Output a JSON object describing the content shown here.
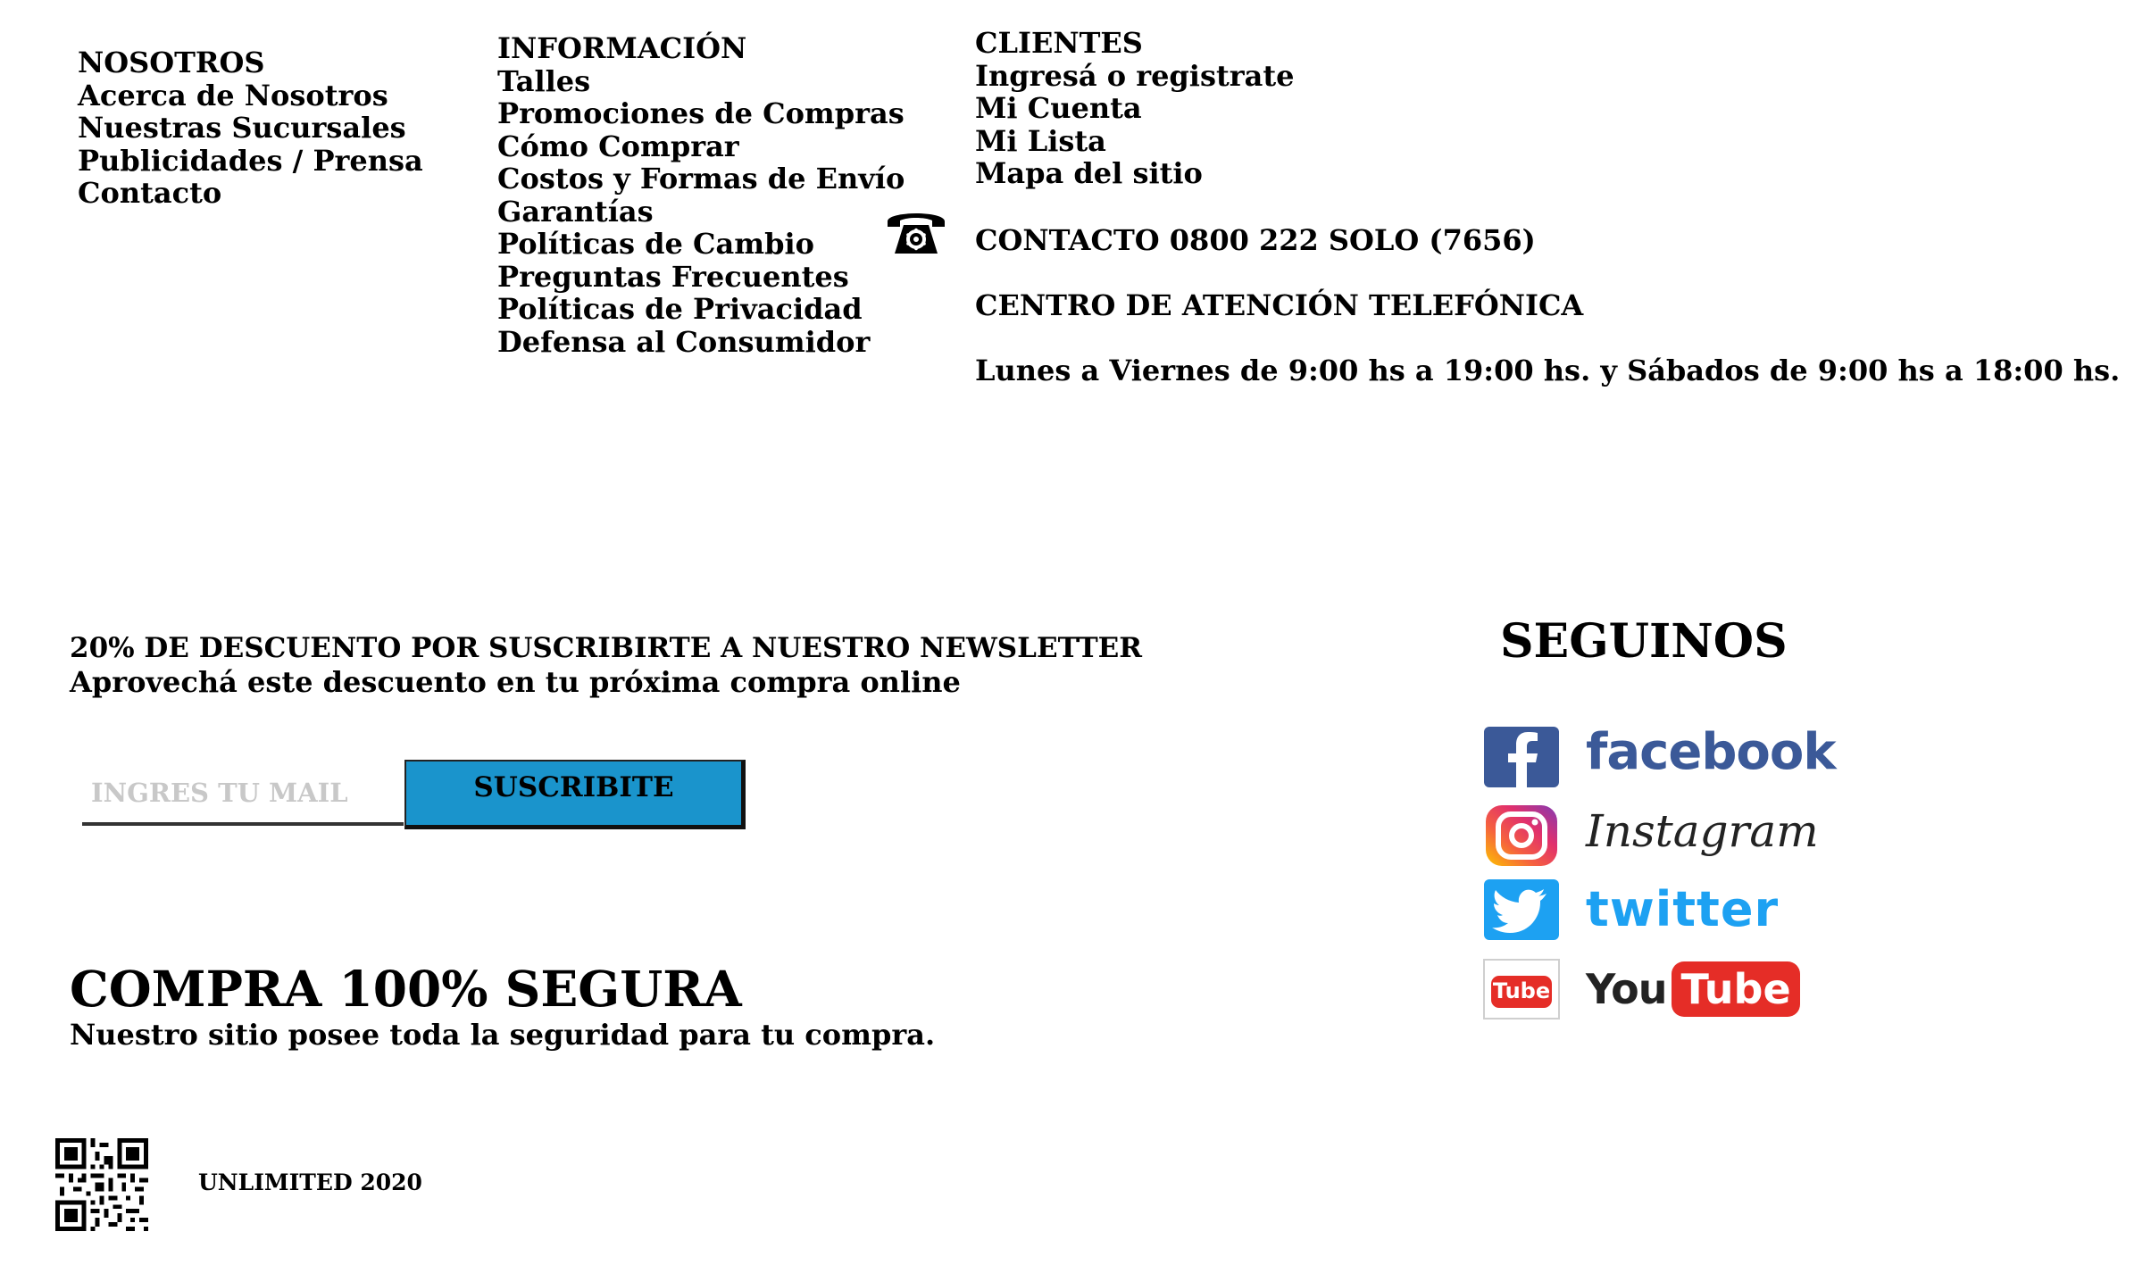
{
  "nosotros": {
    "heading": "NOSOTROS",
    "links": [
      "Acerca de Nosotros",
      "Nuestras Sucursales",
      "Publicidades / Prensa",
      "Contacto"
    ]
  },
  "informacion": {
    "heading": "INFORMACIÓN",
    "links": [
      "Talles",
      "Promociones de Compras",
      "Cómo Comprar",
      "Costos y Formas de Envío",
      "Garantías",
      "Políticas de Cambio",
      "Preguntas Frecuentes",
      "Políticas de Privacidad",
      "Defensa al Consumidor"
    ]
  },
  "clientes": {
    "heading": "CLIENTES",
    "links": [
      "Ingresá o registrate",
      "Mi Cuenta",
      "Mi Lista",
      "Mapa del sitio"
    ]
  },
  "contact": {
    "icon": "telephone-icon",
    "phone_line": "CONTACTO 0800 222 SOLO (7656)",
    "center_label": "CENTRO DE ATENCIÓN TELEFÓNICA",
    "hours": "Lunes a Viernes de 9:00 hs a 19:00 hs. y Sábados de 9:00 hs a 18:00 hs."
  },
  "newsletter": {
    "title": "20% DE DESCUENTO POR SUSCRIBIRTE A NUESTRO NEWSLETTER",
    "subtitle": "Aprovechá este descuento en tu próxima compra online",
    "email_placeholder": "INGRES TU MAIL",
    "email_value": "",
    "button_label": "SUSCRIBITE",
    "button_color": "#1a94cc"
  },
  "social": {
    "heading": "SEGUINOS",
    "networks": [
      {
        "name": "facebook",
        "icon": "facebook-icon",
        "color": "#3b5998"
      },
      {
        "name": "Instagram",
        "icon": "instagram-icon",
        "color": "#c13584"
      },
      {
        "name": "twitter",
        "icon": "twitter-icon",
        "color": "#1da1f2"
      },
      {
        "name_you": "You",
        "name_tube": "Tube",
        "icon_label": "Tube",
        "icon": "youtube-icon",
        "color": "#e52d27"
      }
    ]
  },
  "secure": {
    "title": "COMPRA 100% SEGURA",
    "subtitle": "Nuestro sitio posee toda la seguridad para tu compra."
  },
  "footer": {
    "qr_icon": "qr-code-icon",
    "copyright": "UNLIMITED 2020"
  }
}
